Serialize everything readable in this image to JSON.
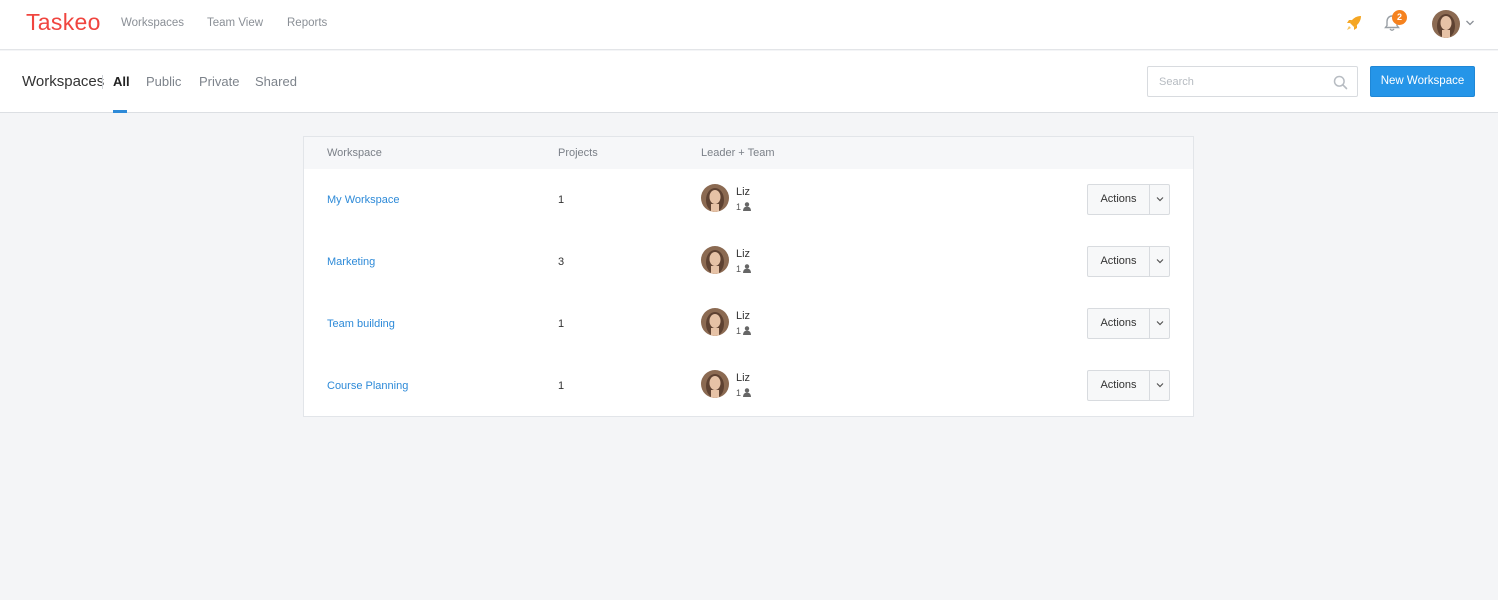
{
  "app": {
    "logo": "Taskeo",
    "nav": [
      "Workspaces",
      "Team View",
      "Reports"
    ],
    "notifications_count": "2",
    "brand_color": "#f0453f",
    "accent_color": "#2595e8",
    "badge_color": "#f5821f",
    "rocket_color": "#f5a623"
  },
  "subheader": {
    "title": "Workspaces",
    "tabs": [
      "All",
      "Public",
      "Private",
      "Shared"
    ],
    "active_tab": "All",
    "search_placeholder": "Search",
    "new_button": "New Workspace"
  },
  "table": {
    "headers": {
      "workspace": "Workspace",
      "projects": "Projects",
      "team": "Leader + Team"
    },
    "rows": [
      {
        "workspace": "My Workspace",
        "projects": "1",
        "leader": "Liz",
        "team_count": "1",
        "action": "Actions"
      },
      {
        "workspace": "Marketing",
        "projects": "3",
        "leader": "Liz",
        "team_count": "1",
        "action": "Actions"
      },
      {
        "workspace": "Team building",
        "projects": "1",
        "leader": "Liz",
        "team_count": "1",
        "action": "Actions"
      },
      {
        "workspace": "Course Planning",
        "projects": "1",
        "leader": "Liz",
        "team_count": "1",
        "action": "Actions"
      }
    ]
  },
  "icons": [
    "rocket-icon",
    "bell-icon",
    "chevron-down-icon",
    "search-icon",
    "user-icon"
  ]
}
